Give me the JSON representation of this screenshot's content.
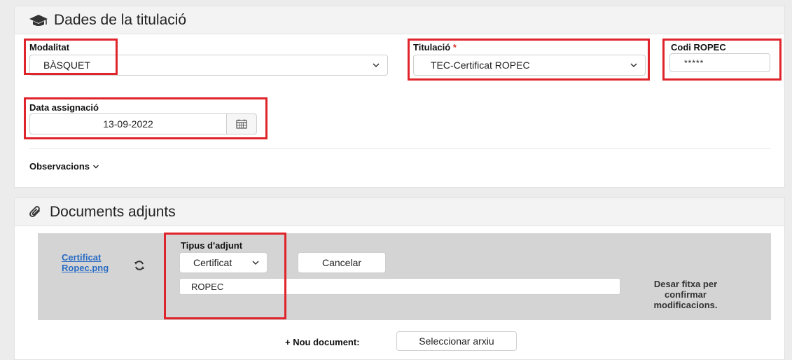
{
  "titulacio_section": {
    "title": "Dades de la titulació",
    "modalitat": {
      "label": "Modalitat",
      "value": "BÀSQUET"
    },
    "titulacio": {
      "label": "Titulació",
      "required_mark": "*",
      "value": "TEC-Certificat ROPEC"
    },
    "codi_ropec": {
      "label": "Codi ROPEC",
      "value": "*****"
    },
    "data_assignacio": {
      "label": "Data assignació",
      "value": "13-09-2022"
    },
    "observacions": {
      "label": "Observacions"
    }
  },
  "documents_section": {
    "title": "Documents adjunts",
    "file_link": {
      "line1": "Certificat",
      "line2": "Ropec.png"
    },
    "tipus_adjunt": {
      "label": "Tipus d'adjunt",
      "value": "Certificat"
    },
    "cancel_label": "Cancelar",
    "description_value": "ROPEC",
    "save_note": {
      "line1": "Desar fitxa per",
      "line2": "confirmar",
      "line3": "modificacions."
    },
    "new_document_label": "+ Nou document:",
    "select_file_label": "Seleccionar arxiu"
  },
  "colors": {
    "highlight": "#e0242b",
    "link": "#2a6cc4",
    "required": "#d9342b"
  },
  "icons": [
    "graduation-cap-icon",
    "chevron-down-icon",
    "calendar-icon",
    "paperclip-icon",
    "refresh-icon"
  ]
}
